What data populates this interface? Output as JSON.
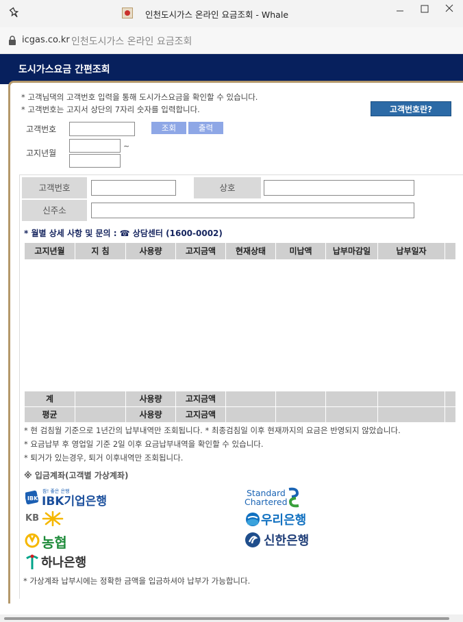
{
  "window": {
    "title": "인천도시가스 온라인 요금조회 - Whale",
    "controls": [
      "minimize",
      "maximize",
      "close"
    ]
  },
  "address_bar": {
    "domain": "icgas.co.kr",
    "page_title": "인천도시가스 온라인 요금조회"
  },
  "header": {
    "title": "도시가스요금 간편조회"
  },
  "notes": {
    "line1": "* 고객님댁의 고객번호 입력을 통해 도시가스요금을 확인할 수 있습니다.",
    "line2": "* 고객번호는 고지서 상단의 7자리 숫자를 입력합니다."
  },
  "customer_number_button": "고객번호란?",
  "form": {
    "customer_label": "고객번호",
    "customer_value": "",
    "period_label": "고지년월",
    "period_from": "",
    "period_to": "",
    "tilde": "~",
    "search_button": "조회",
    "print_button": "출력"
  },
  "info": {
    "customer_number_label": "고객번호",
    "customer_number_value": "",
    "company_label": "상호",
    "company_value": "",
    "address_label": "신주소",
    "address_value": ""
  },
  "section_title": "* 월별 상세 사항 및 문의 : ☎ 상담센터 (1600-0002)",
  "table": {
    "headers": [
      "고지년월",
      "지 침",
      "사용량",
      "고지금액",
      "현재상태",
      "미납액",
      "납부마감일",
      "납부일자"
    ],
    "rows": [],
    "footer": [
      {
        "label": "계",
        "cells": [
          "",
          "사용량",
          "고지금액",
          "",
          "",
          "",
          ""
        ]
      },
      {
        "label": "평균",
        "cells": [
          "",
          "사용량",
          "고지금액",
          "",
          "",
          "",
          ""
        ]
      }
    ]
  },
  "bottom_notes": [
    "* 현 검침월 기준으로 1년간의 납부내역만 조회됩니다. * 최종검침일 이후 현재까지의 요금은 반영되지 않았습니다.",
    "* 요금납부 후 영업일 기준 2일 이후 요금납부내역을 확인할 수 있습니다.",
    "* 퇴거가 있는경우, 퇴거 이후내역만 조회됩니다."
  ],
  "deposit_title": "※ 입금계좌(고객별 가상계좌)",
  "banks": {
    "ibk_sub": "참! 좋은 은행",
    "ibk_main": "IBK기업은행",
    "kb": "KB",
    "nh": "농협",
    "hana": "하나은행",
    "sc_line1": "Standard",
    "sc_line2": "Chartered",
    "woori": "우리은행",
    "shinhan": "신한은행"
  },
  "final_note": "* 가상계좌 납부시에는 정확한 금액을 입금하셔야 납부가 가능합니다.",
  "colors": {
    "header_bg": "#07205d",
    "frame_border": "#b4986a",
    "button_blue": "#8ea7e6",
    "customer_button": "#2c6aa6",
    "section_title": "#15245e"
  }
}
